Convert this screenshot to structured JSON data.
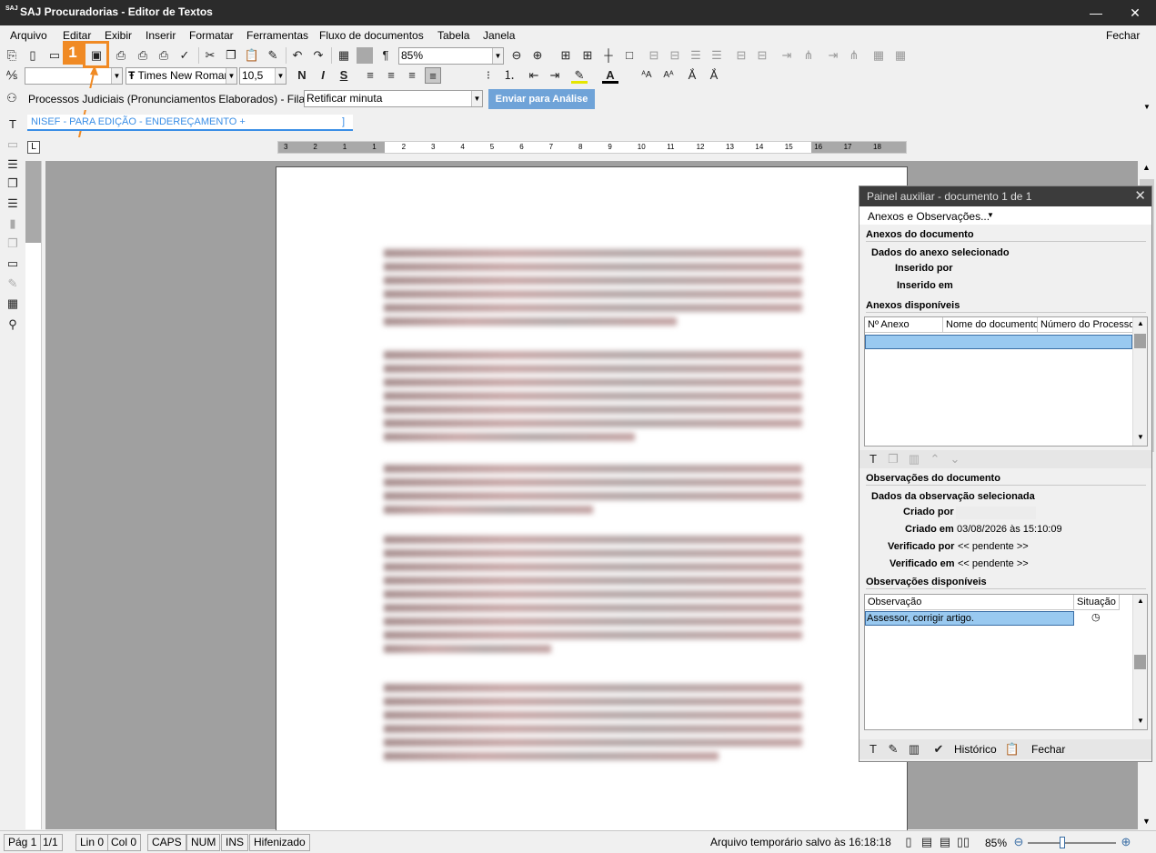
{
  "window": {
    "logo": "SAJ",
    "title": "SAJ Procuradorias - Editor de Textos",
    "minimize": "—",
    "close": "✕"
  },
  "menu": [
    "Arquivo",
    "Editar",
    "Exibir",
    "Inserir",
    "Formatar",
    "Ferramentas",
    "Fluxo de documentos",
    "Tabela",
    "Janela"
  ],
  "menu_close": "Fechar",
  "toolbar": {
    "zoom": "85%",
    "font_name": "Times New Roman",
    "font_size": "10,5",
    "style_box": ""
  },
  "process": {
    "label": "Processos Judiciais (Pronunciamentos Elaborados) - Fila:",
    "queue": "Retificar minuta",
    "send_button": "Enviar para Análise"
  },
  "doc_tab": {
    "label": "NISEF - PARA EDIÇÃO - ENDEREÇAMENTO +",
    "suffix": "]"
  },
  "annotation": {
    "step": "1"
  },
  "ruler_labels": [
    "3",
    "2",
    "1",
    "1",
    "2",
    "3",
    "4",
    "5",
    "6",
    "7",
    "8",
    "9",
    "10",
    "11",
    "12",
    "13",
    "14",
    "15",
    "16",
    "17",
    "18"
  ],
  "panel": {
    "title": "Painel auxiliar - documento 1 de 1",
    "dropdown": "Anexos e Observações...",
    "anexos_title": "Anexos do documento",
    "anexo_dados": "Dados do anexo selecionado",
    "inserido_por": "Inserido por",
    "inserido_em": "Inserido em",
    "anexos_disp": "Anexos disponíveis",
    "anexo_cols": [
      "Nº Anexo",
      "Nome do documento",
      "Número do Processo"
    ],
    "obs_title": "Observações do documento",
    "obs_dados": "Dados da observação selecionada",
    "criado_por_lbl": "Criado por",
    "criado_por_val": "",
    "criado_em_lbl": "Criado em",
    "criado_em_val": "03/08/2026 às 15:10:09",
    "verif_por_lbl": "Verificado por",
    "verif_por_val": "<< pendente >>",
    "verif_em_lbl": "Verificado em",
    "verif_em_val": "<< pendente >>",
    "obs_disp": "Observações disponíveis",
    "obs_cols": [
      "Observação",
      "Situação"
    ],
    "obs_rows": [
      {
        "text": "Assessor, corrigir artigo.",
        "status": "clock-icon"
      }
    ],
    "historico": "Histórico",
    "fechar": "Fechar"
  },
  "status": {
    "page": "Pág 1",
    "pages": "1/1",
    "line": "Lin 0",
    "col": "Col 0",
    "caps": "CAPS",
    "num": "NUM",
    "ins": "INS",
    "hyph": "Hifenizado",
    "saved": "Arquivo temporário salvo às 16:18:18",
    "zoom": "85%"
  },
  "colors": {
    "accent": "#3a8ee6",
    "annotation": "#f08a24",
    "selection": "#99c9f0",
    "titlebar": "#2b2b2b"
  }
}
